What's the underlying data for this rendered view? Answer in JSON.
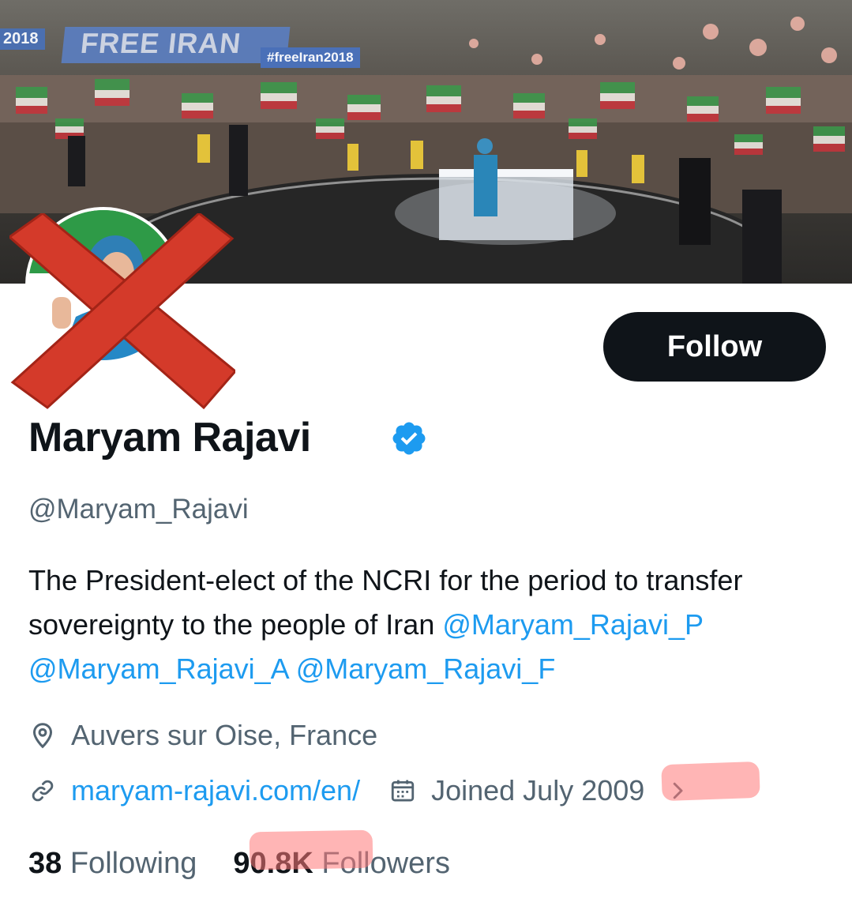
{
  "banner": {
    "year_text": "2018",
    "headline": "FREE IRAN",
    "hashtag": "#freeIran2018"
  },
  "profile": {
    "display_name": "Maryam Rajavi",
    "handle": "@Maryam_Rajavi",
    "verified": true,
    "follow_label": "Follow",
    "bio_text": "The President-elect of the NCRI for the period to transfer sovereignty to the people of Iran ",
    "bio_mentions": [
      "@Maryam_Rajavi_P",
      "@Maryam_Rajavi_A",
      "@Maryam_Rajavi_F"
    ],
    "location": "Auvers sur Oise, France",
    "website": "maryam-rajavi.com/en/",
    "joined": "Joined July 2009"
  },
  "stats": {
    "following_count": "38",
    "following_label": "Following",
    "followers_count": "90.8K",
    "followers_label": "Followers"
  },
  "colors": {
    "accent": "#1d9bf0",
    "text": "#0f1419",
    "muted": "#536471",
    "cross": "#d43a2a",
    "highlight": "#ff7878"
  },
  "icons": [
    "verified-icon",
    "location-pin-icon",
    "link-icon",
    "calendar-icon",
    "chevron-right-icon"
  ]
}
